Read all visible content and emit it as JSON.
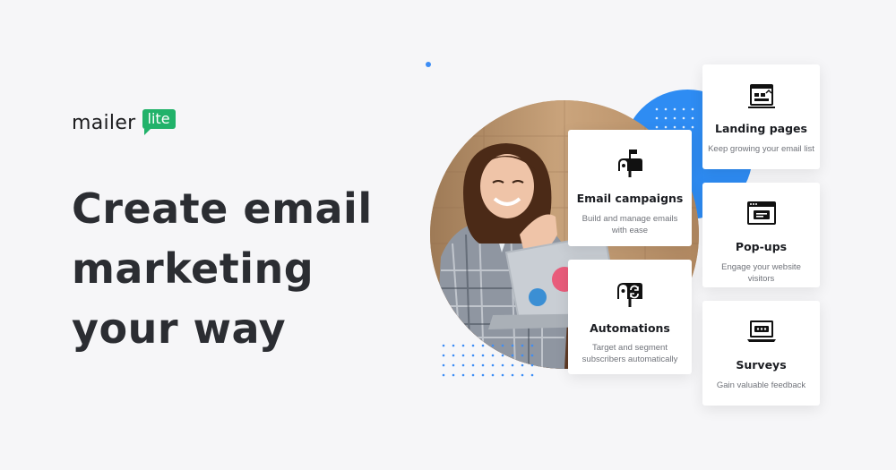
{
  "brand": {
    "word": "mailer",
    "badge": "lite",
    "badge_color": "#21b26a"
  },
  "headline": [
    "Create email",
    "marketing",
    "your way"
  ],
  "accent_color": "#2e8cf3",
  "cards": {
    "email_campaigns": {
      "icon": "mailbox-flag-icon",
      "title": "Email campaigns",
      "desc": "Build and manage emails with ease"
    },
    "automations": {
      "icon": "mailbox-sync-icon",
      "title": "Automations",
      "desc": "Target and segment subscribers automatically"
    },
    "landing_pages": {
      "icon": "landing-page-icon",
      "title": "Landing pages",
      "desc": "Keep growing your email list"
    },
    "popups": {
      "icon": "popup-window-icon",
      "title": "Pop-ups",
      "desc": "Engage your website visitors"
    },
    "surveys": {
      "icon": "survey-laptop-icon",
      "title": "Surveys",
      "desc": "Gain valuable feedback"
    }
  }
}
